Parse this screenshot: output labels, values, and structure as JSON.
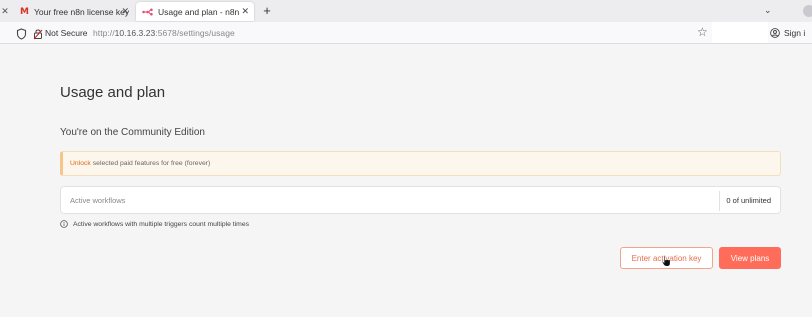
{
  "browser": {
    "tabs": [
      {
        "title": "Your free n8n license key",
        "icon": "gmail-icon",
        "active": false
      },
      {
        "title": "Usage and plan - n8n",
        "icon": "n8n-icon",
        "active": true
      }
    ],
    "new_tab_label": "+",
    "address_bar": {
      "security_label": "Not Secure",
      "url_prefix": "http://",
      "url_host": "10.16.3.23",
      "url_rest": ":5678/settings/usage"
    },
    "signin_label": "Sign i"
  },
  "page": {
    "title": "Usage and plan",
    "edition_text": "You're on the Community Edition",
    "banner": {
      "link_text": "Unlock",
      "text": "selected paid features for free (forever)"
    },
    "active_workflows": {
      "label": "Active workflows",
      "value": "0 of unlimited"
    },
    "info_text": "Active workflows with multiple triggers count multiple times",
    "buttons": {
      "activate_label": "Enter activation key",
      "plans_label": "View plans"
    }
  },
  "colors": {
    "accent": "#ff6d5a",
    "banner_bg": "#fdf6ec",
    "link": "#e0691a",
    "background": "#f5f5f6"
  }
}
